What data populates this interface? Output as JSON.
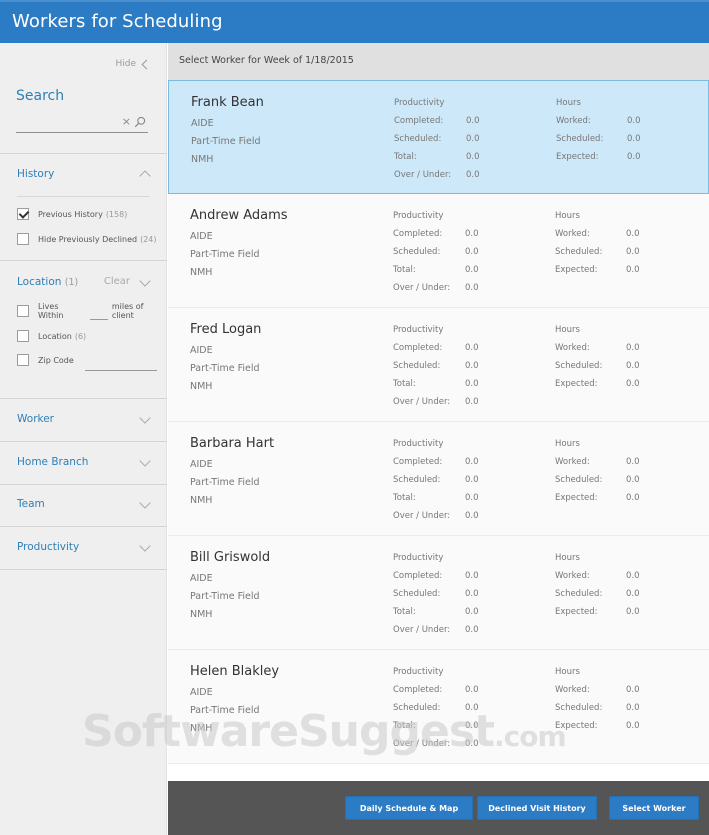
{
  "app": {
    "title": "Workers for Scheduling"
  },
  "sidebar": {
    "hide_label": "Hide",
    "search": {
      "label": "Search",
      "value": "",
      "placeholder": "",
      "clear_icon": "×"
    },
    "history": {
      "label": "History",
      "options": [
        {
          "label": "Previous History",
          "count": "(158)",
          "checked": true
        },
        {
          "label": "Hide Previously Declined",
          "count": "(24)",
          "checked": false
        }
      ]
    },
    "location": {
      "label": "Location",
      "count": "(1)",
      "clear_label": "Clear",
      "options": [
        {
          "label": "Lives Within",
          "suffix": "miles of client",
          "checked": false
        },
        {
          "label": "Location",
          "count": "(6)",
          "checked": false
        },
        {
          "label": "Zip Code",
          "checked": false
        }
      ]
    },
    "sections": [
      {
        "label": "Worker"
      },
      {
        "label": "Home Branch"
      },
      {
        "label": "Team"
      },
      {
        "label": "Productivity"
      }
    ]
  },
  "main": {
    "subheader": "Select Worker for Week of 1/18/2015",
    "column_headers": {
      "productivity": "Productivity",
      "hours": "Hours"
    },
    "productivity_labels": [
      "Completed:",
      "Scheduled:",
      "Total:",
      "Over / Under:"
    ],
    "hours_labels": [
      "Worked:",
      "Scheduled:",
      "Expected:"
    ],
    "workers": [
      {
        "name": "Frank Bean",
        "role": "AIDE",
        "type": "Part-Time Field",
        "branch": "NMH",
        "selected": true,
        "productivity": [
          "0.0",
          "0.0",
          "0.0",
          "0.0"
        ],
        "hours": [
          "0.0",
          "0.0",
          "0.0"
        ]
      },
      {
        "name": "Andrew Adams",
        "role": "AIDE",
        "type": "Part-Time Field",
        "branch": "NMH",
        "selected": false,
        "productivity": [
          "0.0",
          "0.0",
          "0.0",
          "0.0"
        ],
        "hours": [
          "0.0",
          "0.0",
          "0.0"
        ]
      },
      {
        "name": "Fred Logan",
        "role": "AIDE",
        "type": "Part-Time Field",
        "branch": "NMH",
        "selected": false,
        "productivity": [
          "0.0",
          "0.0",
          "0.0",
          "0.0"
        ],
        "hours": [
          "0.0",
          "0.0",
          "0.0"
        ]
      },
      {
        "name": "Barbara Hart",
        "role": "AIDE",
        "type": "Part-Time Field",
        "branch": "NMH",
        "selected": false,
        "productivity": [
          "0.0",
          "0.0",
          "0.0",
          "0.0"
        ],
        "hours": [
          "0.0",
          "0.0",
          "0.0"
        ]
      },
      {
        "name": "Bill Griswold",
        "role": "AIDE",
        "type": "Part-Time Field",
        "branch": "NMH",
        "selected": false,
        "productivity": [
          "0.0",
          "0.0",
          "0.0",
          "0.0"
        ],
        "hours": [
          "0.0",
          "0.0",
          "0.0"
        ]
      },
      {
        "name": "Helen Blakley",
        "role": "AIDE",
        "type": "Part-Time Field",
        "branch": "NMH",
        "selected": false,
        "productivity": [
          "0.0",
          "0.0",
          "0.0",
          "0.0"
        ],
        "hours": [
          "0.0",
          "0.0",
          "0.0"
        ]
      }
    ]
  },
  "footer": {
    "buttons": [
      {
        "label": "Daily Schedule & Map"
      },
      {
        "label": "Declined Visit History"
      },
      {
        "label": "Select Worker"
      }
    ]
  },
  "watermark": {
    "text": "SoftwareSuggest",
    "suffix": ".com"
  },
  "colors": {
    "brand_blue": "#2c7cc5",
    "link_blue": "#2e7fb8",
    "selected_bg": "#cde9f9",
    "footer_bg": "#555555"
  }
}
